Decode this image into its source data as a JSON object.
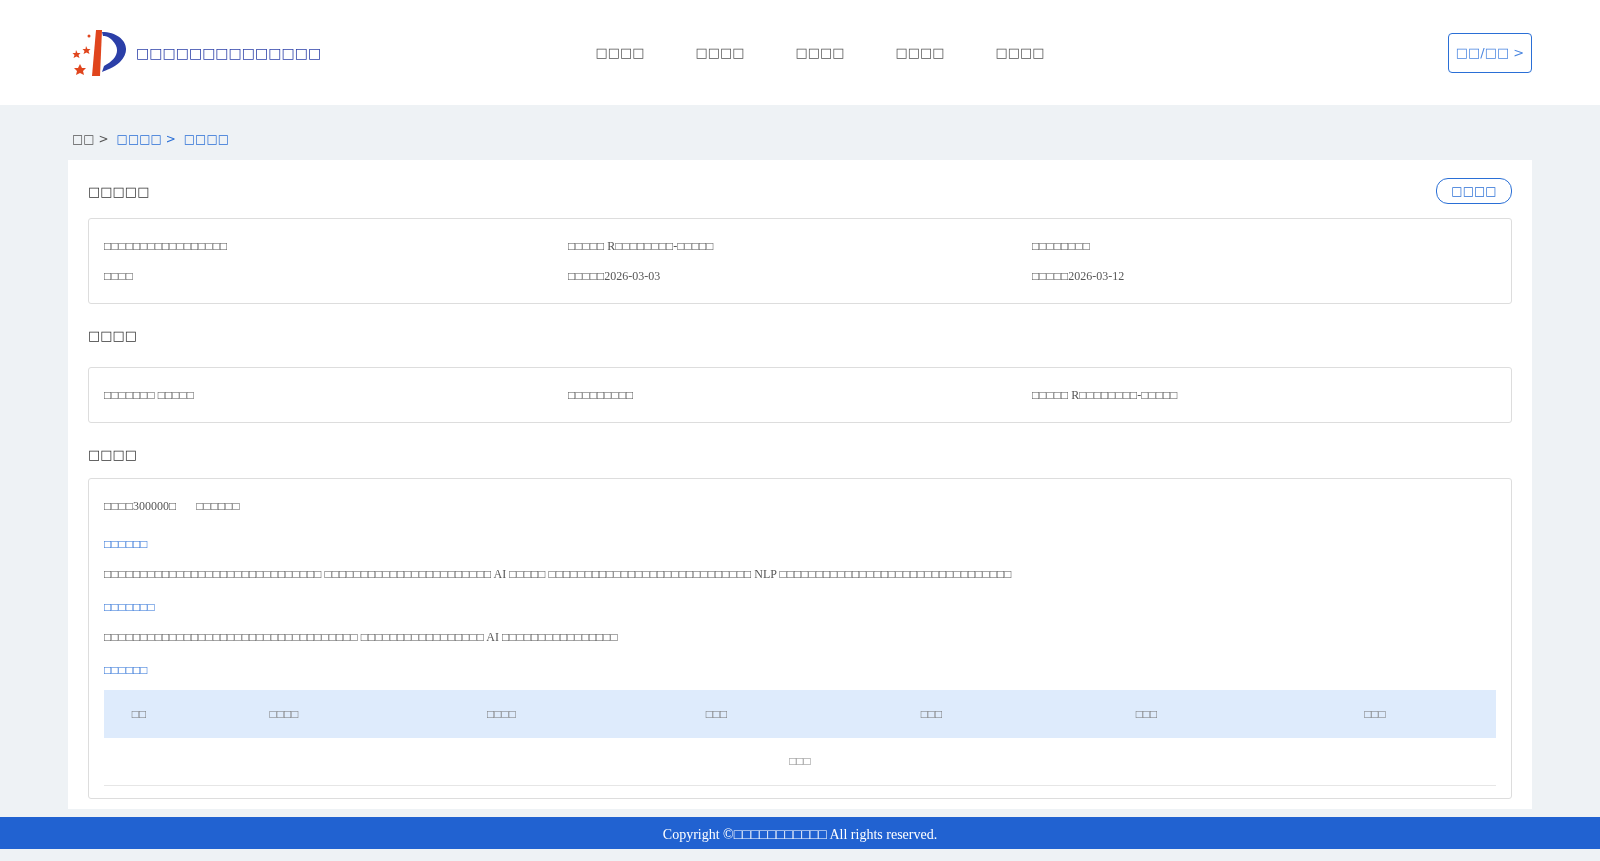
{
  "header": {
    "site_title": "□□□□□□□□□□□□□□",
    "nav": [
      "□□□□",
      "□□□□",
      "□□□□",
      "□□□□",
      "□□□□"
    ],
    "login": "□□/□□ >"
  },
  "breadcrumb": [
    {
      "label": "□□ >",
      "link": false
    },
    {
      "label": "□□□□ >",
      "link": true
    },
    {
      "label": "□□□□",
      "link": true
    }
  ],
  "info": {
    "title": "□□□□□",
    "action": "□□□□",
    "rows": [
      [
        "□□□□□□□□□□□□□□□□□",
        "□□□□□ R□□□□□□□□-□□□□□",
        "□□□□□□□□"
      ],
      [
        "□□□□",
        "□□□□□2026-03-03",
        "□□□□□2026-03-12"
      ]
    ]
  },
  "party": {
    "title": "□□□□",
    "rows": [
      [
        "□□□□□□□ □□□□□",
        "□□□□□□□□□",
        "□□□□□ R□□□□□□□□-□□□□□"
      ]
    ]
  },
  "detail": {
    "title": "□□□□",
    "meta": [
      "□□□□300000□",
      "□□□□□□"
    ],
    "sections": [
      {
        "heading": "□□□□□□",
        "text": "□□□□□□□□□□□□□□□□□□□□□□□□□□□□□□ □□□□□□□□□□□□□□□□□□□□□□□ AI □□□□□ □□□□□□□□□□□□□□□□□□□□□□□□□□□□ NLP □□□□□□□□□□□□□□□□□□□□□□□□□□□□□□□□"
      },
      {
        "heading": "□□□□□□□",
        "text": "□□□□□□□□□□□□□□□□□□□□□□□□□□□□□□□□□□□ □□□□□□□□□□□□□□□□□ AI □□□□□□□□□□□□□□□□"
      }
    ],
    "table_heading": "□□□□□□",
    "table": {
      "columns": [
        "□□",
        "□□□□",
        "□□□□",
        "□□□",
        "□□□",
        "□□□",
        "□□□"
      ],
      "empty": "□□□"
    }
  },
  "footer": "Copyright ©□□□□□□□□□□□ All rights reserved."
}
